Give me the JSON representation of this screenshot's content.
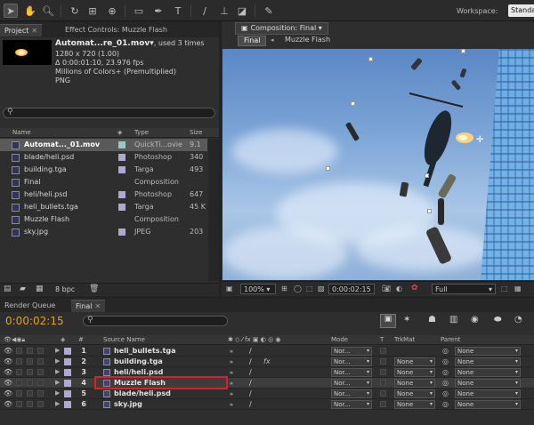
{
  "toolbar": {
    "workspace_label": "Workspace:",
    "workspace_value": "Standard"
  },
  "project_panel": {
    "tab_project": "Project",
    "tab_effect_controls": "Effect Controls: Muzzle Flash",
    "selected": {
      "name": "Automat...re_01.mov▾",
      "used": ", used 3 times",
      "resolution": "1280 x 720 (1.00)",
      "duration": "Δ 0:00:01:10, 23.976 fps",
      "colors": "Millions of Colors+ (Premultiplied)",
      "codec": "PNG"
    },
    "columns": {
      "name": "Name",
      "type": "Type",
      "size": "Size"
    },
    "items": [
      {
        "name": "Automat..._01.mov",
        "type": "QuickTi...ovie",
        "size": "9.1",
        "label_color": "#9ec6c6",
        "selected": true
      },
      {
        "name": "blade/heli.psd",
        "type": "Photoshop",
        "size": "340",
        "label_color": "#b0a8d0",
        "selected": false
      },
      {
        "name": "building.tga",
        "type": "Targa",
        "size": "493",
        "label_color": "#b0a8d0",
        "selected": false
      },
      {
        "name": "Final",
        "type": "Composition",
        "size": "",
        "label_color": "",
        "selected": false
      },
      {
        "name": "heli/heli.psd",
        "type": "Photoshop",
        "size": "647",
        "label_color": "#b0a8d0",
        "selected": false
      },
      {
        "name": "heli_bullets.tga",
        "type": "Targa",
        "size": "45 K",
        "label_color": "#b0a8d0",
        "selected": false
      },
      {
        "name": "Muzzle Flash",
        "type": "Composition",
        "size": "",
        "label_color": "",
        "selected": false
      },
      {
        "name": "sky.jpg",
        "type": "JPEG",
        "size": "203",
        "label_color": "#b0a8d0",
        "selected": false
      }
    ],
    "footer_bpc": "8 bpc"
  },
  "comp_panel": {
    "tab_label": "Composition: Final",
    "breadcrumb_current": "Final",
    "breadcrumb_next": "Muzzle Flash",
    "zoom": "100%",
    "timecode": "0:00:02:15",
    "resolution": "Full"
  },
  "timeline": {
    "tab_render_queue": "Render Queue",
    "tab_final": "Final",
    "timecode": "0:00:02:15",
    "columns": {
      "hash": "#",
      "source_name": "Source Name",
      "mode": "Mode",
      "t": "T",
      "trkmat": "TrkMat",
      "parent": "Parent"
    },
    "layers": [
      {
        "num": "1",
        "name": "heli_bullets.tga",
        "label_color": "#b0a8d0",
        "mode": "Nor...",
        "trkmat": "",
        "parent": "None",
        "fx": false
      },
      {
        "num": "2",
        "name": "building.tga",
        "label_color": "#b0a8d0",
        "mode": "Nor...",
        "trkmat": "None",
        "parent": "None",
        "fx": true
      },
      {
        "num": "3",
        "name": "heli/heli.psd",
        "label_color": "#b0a8d0",
        "mode": "Nor...",
        "trkmat": "None",
        "parent": "None",
        "fx": false
      },
      {
        "num": "4",
        "name": "Muzzle Flash",
        "label_color": "#b0a8d0",
        "mode": "Nor...",
        "trkmat": "None",
        "parent": "None",
        "fx": false
      },
      {
        "num": "5",
        "name": "blade/heli.psd",
        "label_color": "#b0a8d0",
        "mode": "Nor...",
        "trkmat": "None",
        "parent": "None",
        "fx": false
      },
      {
        "num": "6",
        "name": "sky.jpg",
        "label_color": "#b0a8d0",
        "mode": "Nor...",
        "trkmat": "None",
        "parent": "None",
        "fx": false
      }
    ]
  },
  "colors": {
    "timecode": "#e0a020",
    "highlight_box": "#e02020",
    "panel_bg": "#2e2e2e"
  }
}
